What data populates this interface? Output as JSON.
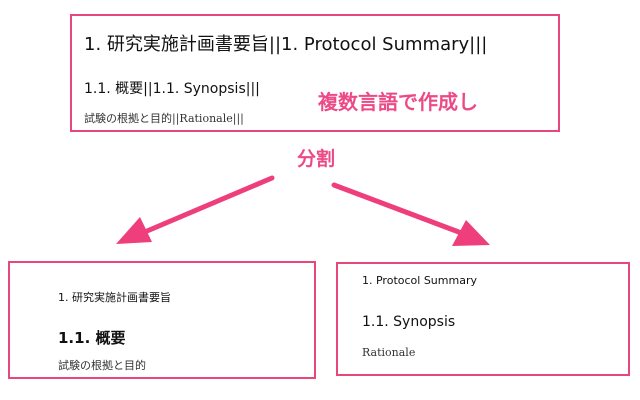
{
  "source": {
    "heading1": "1. 研究実施計画書要旨||1. Protocol Summary|||",
    "heading2": "1.1. 概要||1.1. Synopsis|||",
    "body": "試験の根拠と目的||Rationale|||"
  },
  "annotation": "複数言語で作成し",
  "split_label": "分割",
  "japanese_doc": {
    "heading1": "1. 研究実施計画書要旨",
    "heading2": "1.1. 概要",
    "body": "試験の根拠と目的"
  },
  "english_doc": {
    "heading1": "1. Protocol Summary",
    "heading2": "1.1. Synopsis",
    "body": "Rationale"
  },
  "colors": {
    "accent": "#e8477a",
    "label": "#ec4a87",
    "arrow": "#ee3f7c"
  }
}
